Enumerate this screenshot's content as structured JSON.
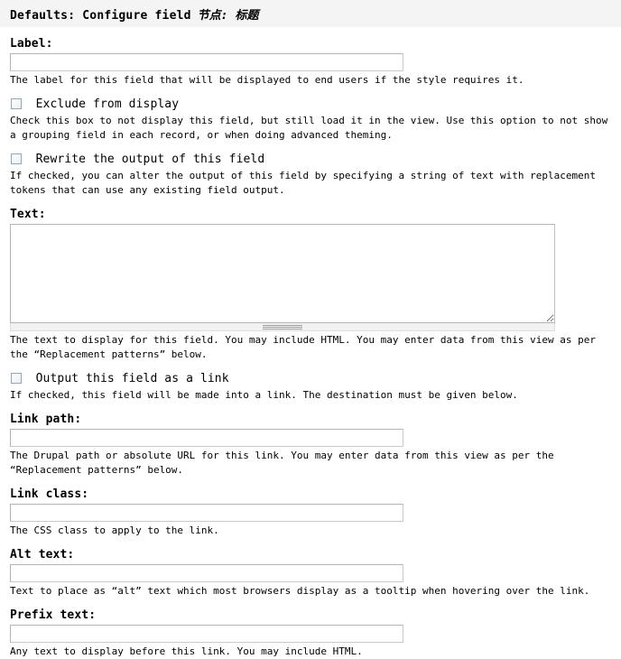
{
  "header": {
    "title": "Defaults: Configure field",
    "subtitle": "节点: 标题"
  },
  "fields": {
    "label": {
      "label": "Label:",
      "value": "",
      "placeholder": "",
      "description": "The label for this field that will be displayed to end users if the style requires it."
    },
    "exclude": {
      "label": "Exclude from display",
      "checked": false,
      "description": "Check this box to not display this field, but still load it in the view. Use this option to not show a grouping field in each record, or when doing advanced theming."
    },
    "rewrite": {
      "label": "Rewrite the output of this field",
      "checked": false,
      "description": "If checked, you can alter the output of this field by specifying a string of text with replacement tokens that can use any existing field output."
    },
    "text": {
      "label": "Text:",
      "value": "",
      "placeholder": "",
      "description": "The text to display for this field. You may include HTML. You may enter data from this view as per the “Replacement patterns” below."
    },
    "output_link": {
      "label": "Output this field as a link",
      "checked": false,
      "description": "If checked, this field will be made into a link. The destination must be given below."
    },
    "link_path": {
      "label": "Link path:",
      "value": "",
      "placeholder": "",
      "description": "The Drupal path or absolute URL for this link. You may enter data from this view as per the “Replacement patterns” below."
    },
    "link_class": {
      "label": "Link class:",
      "value": "",
      "placeholder": "",
      "description": "The CSS class to apply to the link."
    },
    "alt_text": {
      "label": "Alt text:",
      "value": "",
      "placeholder": "",
      "description": "Text to place as “alt” text which most browsers display as a tooltip when hovering over the link."
    },
    "prefix_text": {
      "label": "Prefix text:",
      "value": "",
      "placeholder": "",
      "description": "Any text to display before this link. You may include HTML."
    }
  },
  "colors": {
    "header_background": "#f4f4f4",
    "input_border": "#b3b3b3",
    "checkbox_border": "#8fa8bd",
    "grippie_background": "#f2f2f2",
    "page_background": "#ffffff",
    "text": "#000000"
  }
}
